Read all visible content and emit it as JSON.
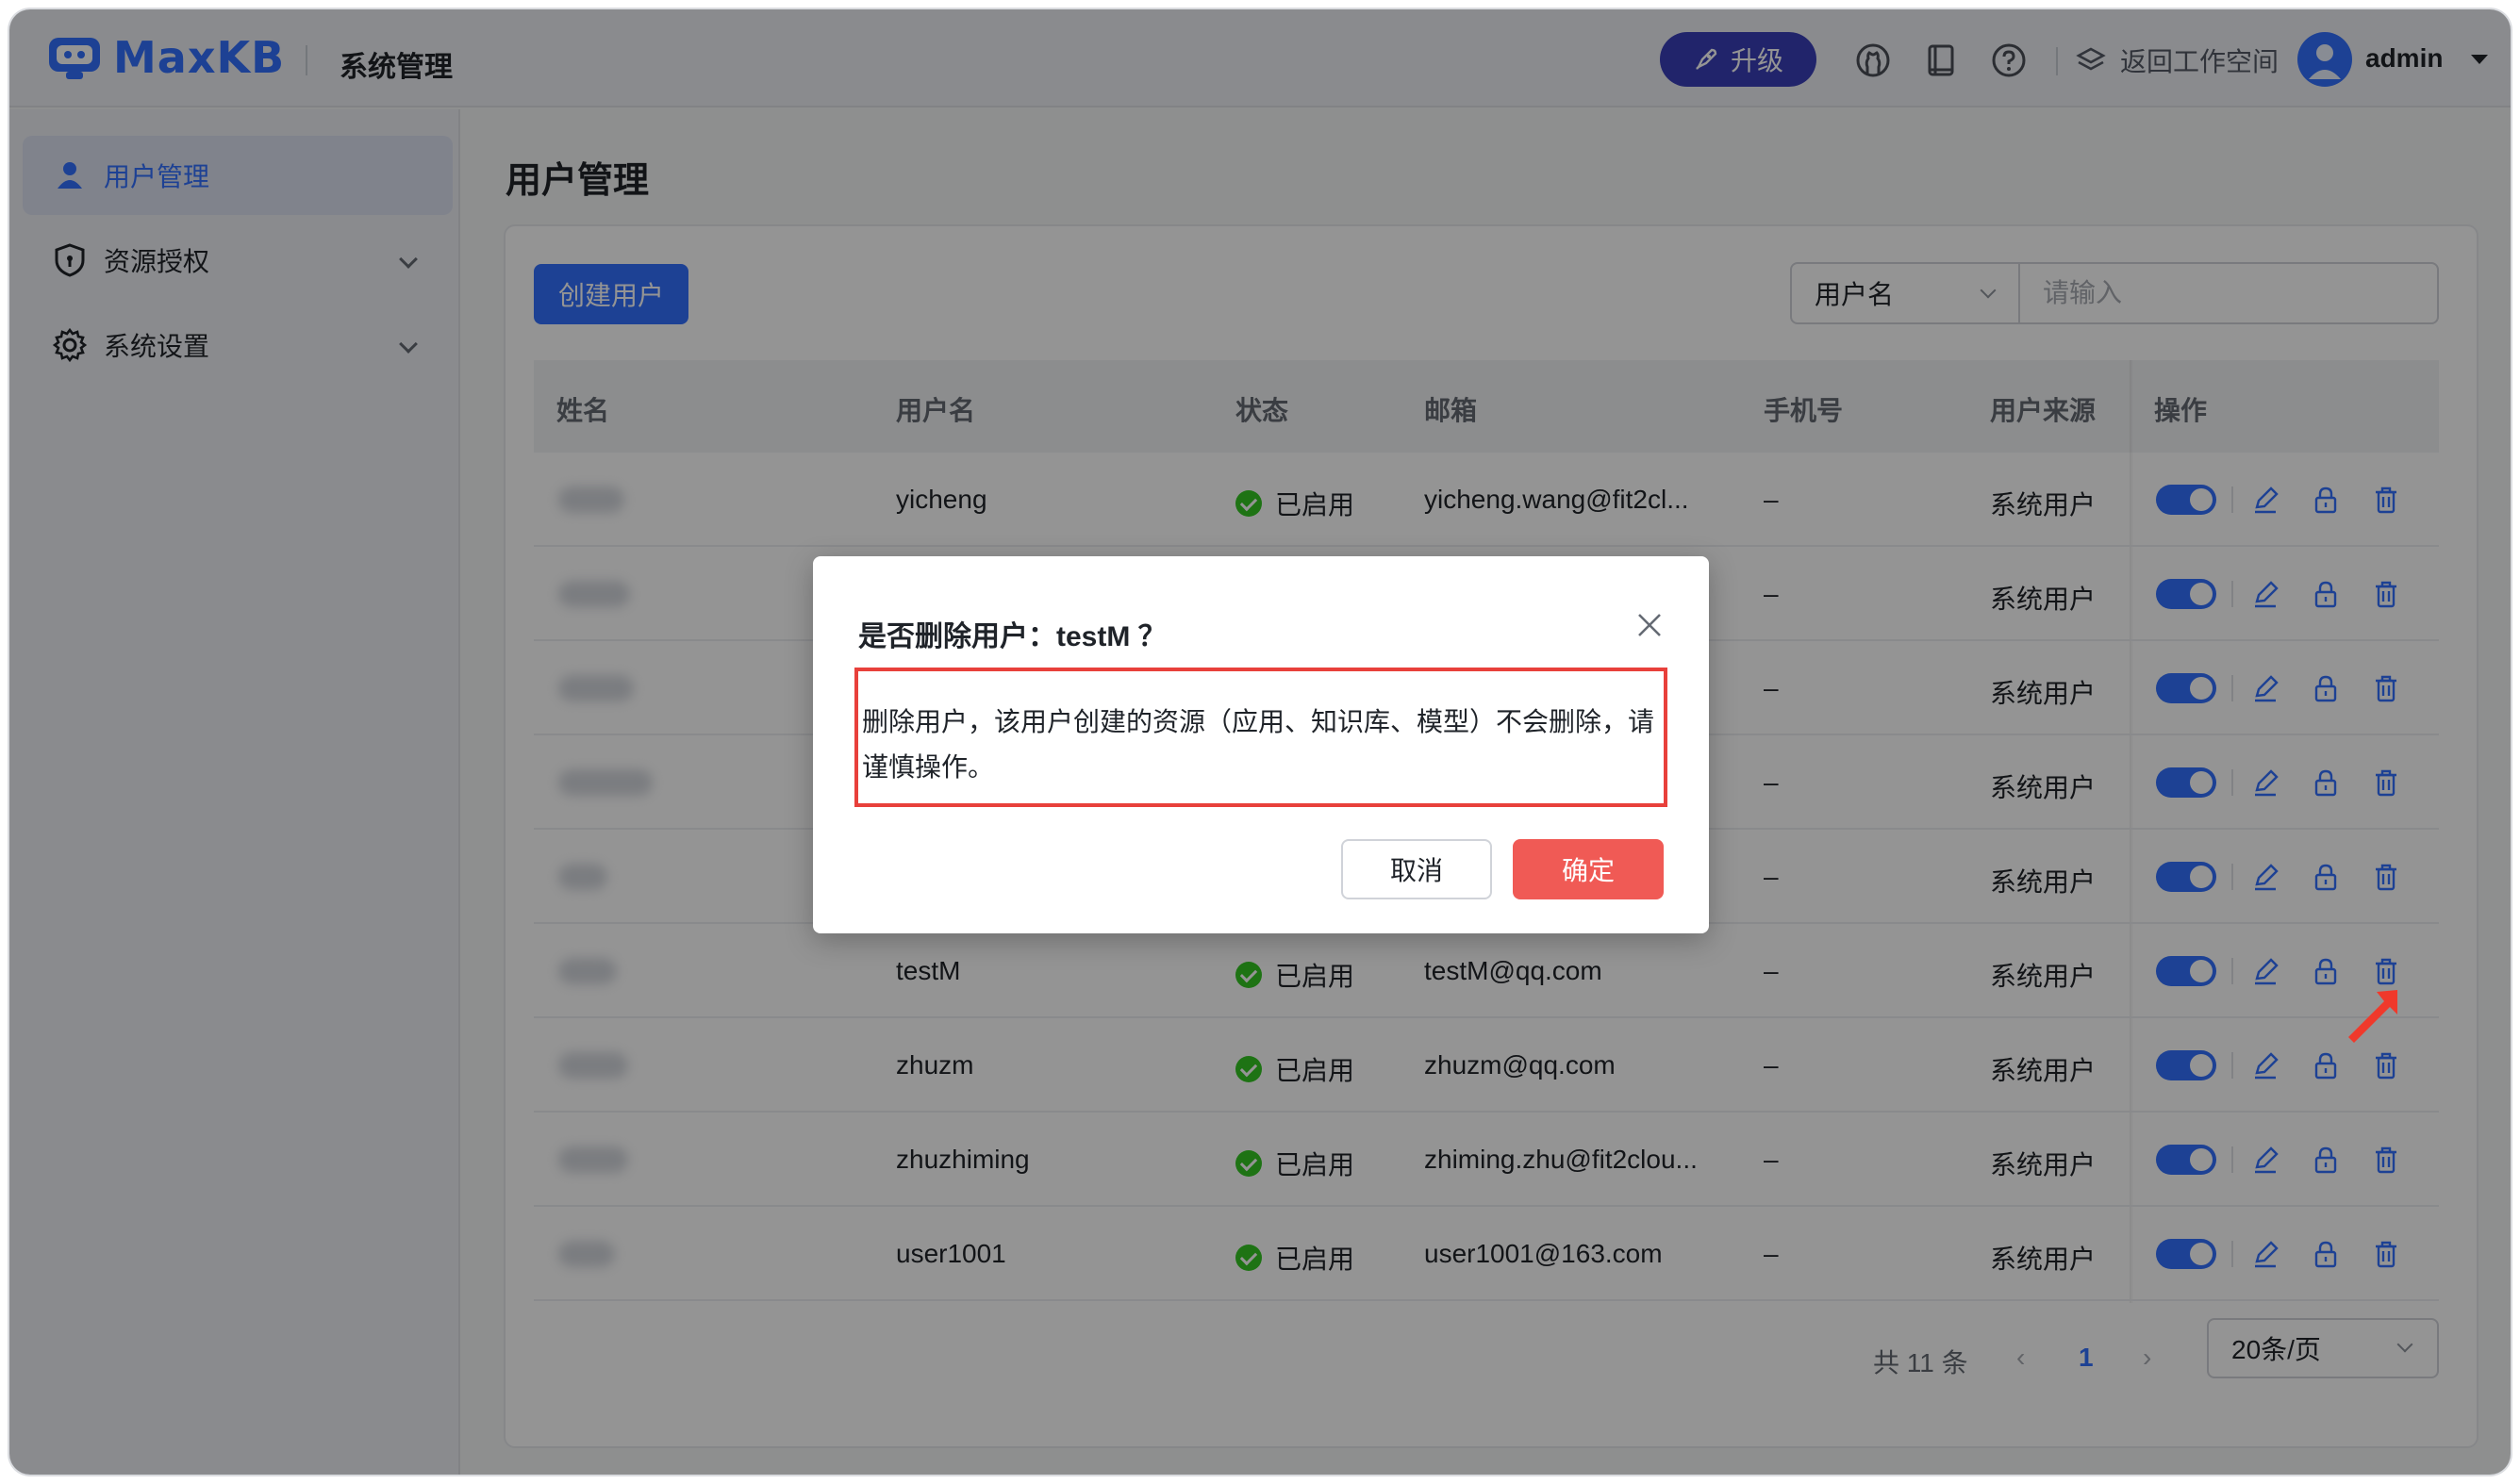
{
  "header": {
    "logo_text": "MaxKB",
    "title": "系统管理",
    "upgrade_label": "升级",
    "workspace_label": "返回工作空间",
    "username": "admin",
    "icons": [
      "rocket-icon",
      "github-icon",
      "book-icon",
      "help-icon",
      "layers-icon",
      "user-avatar-icon"
    ]
  },
  "sidebar": {
    "items": [
      {
        "label": "用户管理",
        "icon": "user-icon",
        "active": true
      },
      {
        "label": "资源授权",
        "icon": "shield-icon",
        "active": false
      },
      {
        "label": "系统设置",
        "icon": "gear-icon",
        "active": false
      }
    ]
  },
  "main": {
    "page_title": "用户管理",
    "create_label": "创建用户",
    "search_field": "用户名",
    "search_placeholder": "请输入"
  },
  "table": {
    "columns": [
      "姓名",
      "用户名",
      "状态",
      "邮箱",
      "手机号",
      "用户来源",
      "操作"
    ],
    "rows": [
      {
        "username": "yicheng",
        "status": "已启用",
        "email": "yicheng.wang@fit2cl...",
        "phone": "–",
        "source": "系统用户"
      },
      {
        "username": "",
        "status": "",
        "email": "",
        "phone": "–",
        "source": "系统用户"
      },
      {
        "username": "",
        "status": "",
        "email": "",
        "phone": "–",
        "source": "系统用户"
      },
      {
        "username": "",
        "status": "",
        "email": "",
        "phone": "–",
        "source": "系统用户"
      },
      {
        "username": "",
        "status": "",
        "email": "",
        "phone": "–",
        "source": "系统用户"
      },
      {
        "username": "testM",
        "status": "已启用",
        "email": "testM@qq.com",
        "phone": "–",
        "source": "系统用户"
      },
      {
        "username": "zhuzm",
        "status": "已启用",
        "email": "zhuzm@qq.com",
        "phone": "–",
        "source": "系统用户"
      },
      {
        "username": "zhuzhiming",
        "status": "已启用",
        "email": "zhiming.zhu@fit2clou...",
        "phone": "–",
        "source": "系统用户"
      },
      {
        "username": "user1001",
        "status": "已启用",
        "email": "user1001@163.com",
        "phone": "–",
        "source": "系统用户"
      }
    ]
  },
  "pagination": {
    "total": "共 11 条",
    "current": "1",
    "page_size": "20条/页"
  },
  "dialog": {
    "title": "是否删除用户：testM ？",
    "body": "删除用户，该用户创建的资源（应用、知识库、模型）不会删除，请谨慎操作。",
    "cancel_label": "取消",
    "confirm_label": "确定"
  },
  "colors": {
    "primary": "#3370ff",
    "upgrade": "#3a3fb8",
    "danger": "#f05a55",
    "highlight_border": "#e8403b",
    "success": "#34c724"
  }
}
